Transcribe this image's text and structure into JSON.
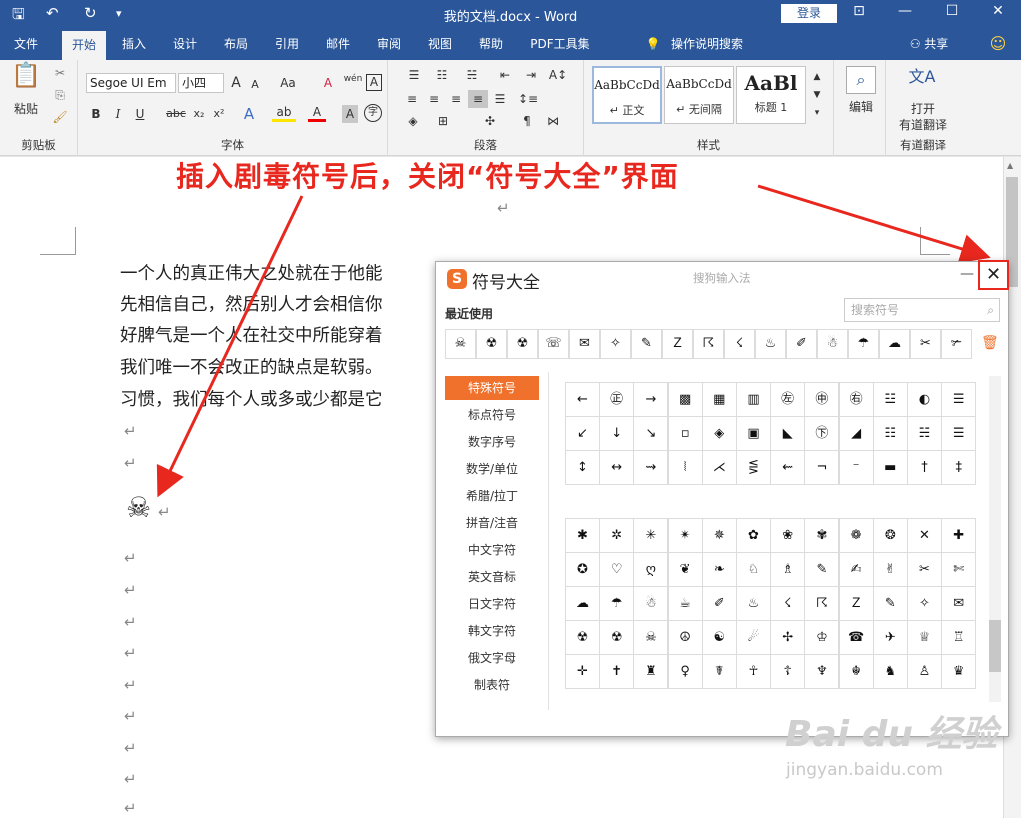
{
  "window": {
    "title": "我的文档.docx - Word",
    "login_label": "登录",
    "quick_access": {
      "save": "🖫",
      "undo": "↶",
      "redo": "↻",
      "more": "▾"
    },
    "controls": {
      "ribbon_display": "⊡",
      "minimize": "—",
      "maximize": "☐",
      "close": "✕"
    }
  },
  "tabs": [
    {
      "label": "文件",
      "active": false
    },
    {
      "label": "开始",
      "active": true
    },
    {
      "label": "插入",
      "active": false
    },
    {
      "label": "设计",
      "active": false
    },
    {
      "label": "布局",
      "active": false
    },
    {
      "label": "引用",
      "active": false
    },
    {
      "label": "邮件",
      "active": false
    },
    {
      "label": "审阅",
      "active": false
    },
    {
      "label": "视图",
      "active": false
    },
    {
      "label": "帮助",
      "active": false
    },
    {
      "label": "PDF工具集",
      "active": false
    },
    {
      "label": "操作说明搜索",
      "active": false
    }
  ],
  "share_label": "共享",
  "lightbulb_icon": "💡",
  "ribbon": {
    "clipboard": {
      "group_label": "剪贴板",
      "paste_label": "粘贴"
    },
    "font": {
      "group_label": "字体",
      "font_name": "Segoe UI Em",
      "font_size": "小四",
      "bold": "B",
      "italic": "I",
      "underline": "U",
      "strike": "abc",
      "sub": "x₂",
      "sup": "x²",
      "grow": "A",
      "shrink": "A",
      "case": "Aa",
      "clear": "A",
      "pinyin": "wén",
      "border": "A",
      "color_a": "A",
      "highlight": "ab",
      "shade": "A",
      "circle": "字"
    },
    "paragraph": {
      "group_label": "段落"
    },
    "styles": {
      "group_label": "样式",
      "items": [
        {
          "sample": "AaBbCcDd",
          "name": "↵ 正文"
        },
        {
          "sample": "AaBbCcDd",
          "name": "↵ 无间隔"
        },
        {
          "sample": "AaBl",
          "name": "标题 1"
        }
      ]
    },
    "editing": {
      "label": "编辑",
      "search_icon": "⌕"
    },
    "translate": {
      "label_line1": "打开",
      "label_line2": "有道翻译",
      "group_label": "有道翻译"
    }
  },
  "annotation": "插入剧毒符号后，关闭“符号大全”界面",
  "document": {
    "lines": [
      "一个人的真正伟大之处就在于他能",
      "先相信自己，然后别人才会相信你",
      "好脾气是一个人在社交中所能穿着",
      "我们唯一不会改正的缺点是软弱。",
      "习惯，我们每个人或多或少都是它"
    ],
    "inserted_symbol": "☠",
    "para_mark": "↵"
  },
  "dialog": {
    "title": "符号大全",
    "subtitle": "搜狗输入法",
    "logo": "S",
    "minimize": "—",
    "close": "✕",
    "search_placeholder": "搜索符号",
    "recent_label": "最近使用",
    "recent": [
      "☠",
      "☢",
      "☢",
      "☏",
      "✉",
      "✧",
      "✎",
      "Ｚ",
      "☈",
      "☇",
      "♨",
      "✐",
      "☃",
      "☂",
      "☁",
      "✂",
      "✃"
    ],
    "trash_icon": "🗑",
    "categories": [
      "特殊符号",
      "标点符号",
      "数字序号",
      "数学/单位",
      "希腊/拉丁",
      "拼音/注音",
      "中文字符",
      "英文音标",
      "日文字符",
      "韩文字符",
      "俄文字母",
      "制表符"
    ],
    "grid_top": [
      [
        "←",
        "㊣",
        "→",
        "▩",
        "▦",
        "▥",
        "㊧",
        "㊥",
        "㊨",
        "☳",
        "◐",
        "☰"
      ],
      [
        "↙",
        "↓",
        "↘",
        "▫",
        "◈",
        "▣",
        "◣",
        "㊦",
        "◢",
        "☷",
        "☵",
        "☰"
      ],
      [
        "↕",
        "↔",
        "⇝",
        "⦚",
        "⋌",
        "⋚",
        "⇜",
        "¬",
        "⁻",
        "▬",
        "†",
        "‡"
      ]
    ],
    "grid_bottom": [
      [
        "✱",
        "✲",
        "✳",
        "✴",
        "✵",
        "✿",
        "❀",
        "✾",
        "❁",
        "❂",
        "✕",
        "✚"
      ],
      [
        "✪",
        "♡",
        "ღ",
        "❦",
        "❧",
        "♘",
        "♗",
        "✎",
        "✍",
        "✌",
        "✂",
        "✄"
      ],
      [
        "☁",
        "☂",
        "☃",
        "☕",
        "✐",
        "♨",
        "☇",
        "☈",
        "Ｚ",
        "✎",
        "✧",
        "✉"
      ],
      [
        "☢",
        "☢",
        "☠",
        "☮",
        "☯",
        "☄",
        "✢",
        "♔",
        "☎",
        "✈",
        "♕",
        "♖"
      ],
      [
        "✛",
        "✝",
        "♜",
        "♀",
        "☤",
        "☥",
        "☦",
        "♆",
        "☬",
        "♞",
        "♙",
        "♛"
      ]
    ]
  },
  "watermark": {
    "brand": "Bai du 经验",
    "url": "jingyan.baidu.com"
  },
  "colors": {
    "ribbon_blue": "#2b579a",
    "accent_orange": "#f0712b",
    "annotation_red": "#e8281e"
  }
}
